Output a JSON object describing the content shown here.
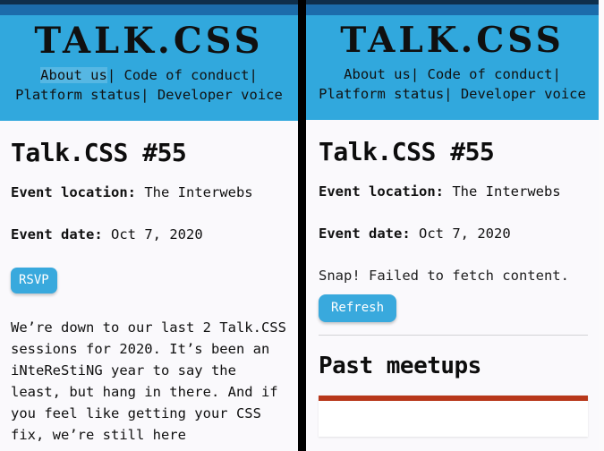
{
  "site": {
    "logo": "TALK.CSS",
    "nav": {
      "items": [
        {
          "label": "About us",
          "focused": true
        },
        {
          "label": "Code of conduct",
          "focused": false
        },
        {
          "label": "Platform status",
          "focused": false
        },
        {
          "label": "Developer voice",
          "focused": false
        }
      ],
      "separator": "|"
    }
  },
  "colors": {
    "header_blue": "#31a8dd",
    "header_blue_dark": "#1c6cab",
    "topbar_navy": "#0f2f4c",
    "page_background": "#faf9fc",
    "button_blue": "#39a9dd",
    "accent_orange": "#b8381b",
    "rule_gray": "#d2d2d6",
    "text_black": "#101010"
  },
  "left_pane": {
    "event": {
      "title": "Talk.CSS #55",
      "location_label": "Event location:",
      "location_value": "The Interwebs",
      "date_label": "Event date:",
      "date_value": "Oct 7, 2020",
      "rsvp_label": "RSVP"
    },
    "blurb": "We’re down to our last 2 Talk.CSS sessions for 2020. It’s been an iNteReStiNG year to say the least, but hang in there. And if you feel like getting your CSS fix, we’re still here"
  },
  "right_pane": {
    "event": {
      "title": "Talk.CSS #55",
      "location_label": "Event location:",
      "location_value": "The Interwebs",
      "date_label": "Event date:",
      "date_value": "Oct 7, 2020",
      "error_message": "Snap! Failed to fetch content.",
      "refresh_label": "Refresh"
    },
    "past_meetups": {
      "heading": "Past meetups"
    }
  }
}
